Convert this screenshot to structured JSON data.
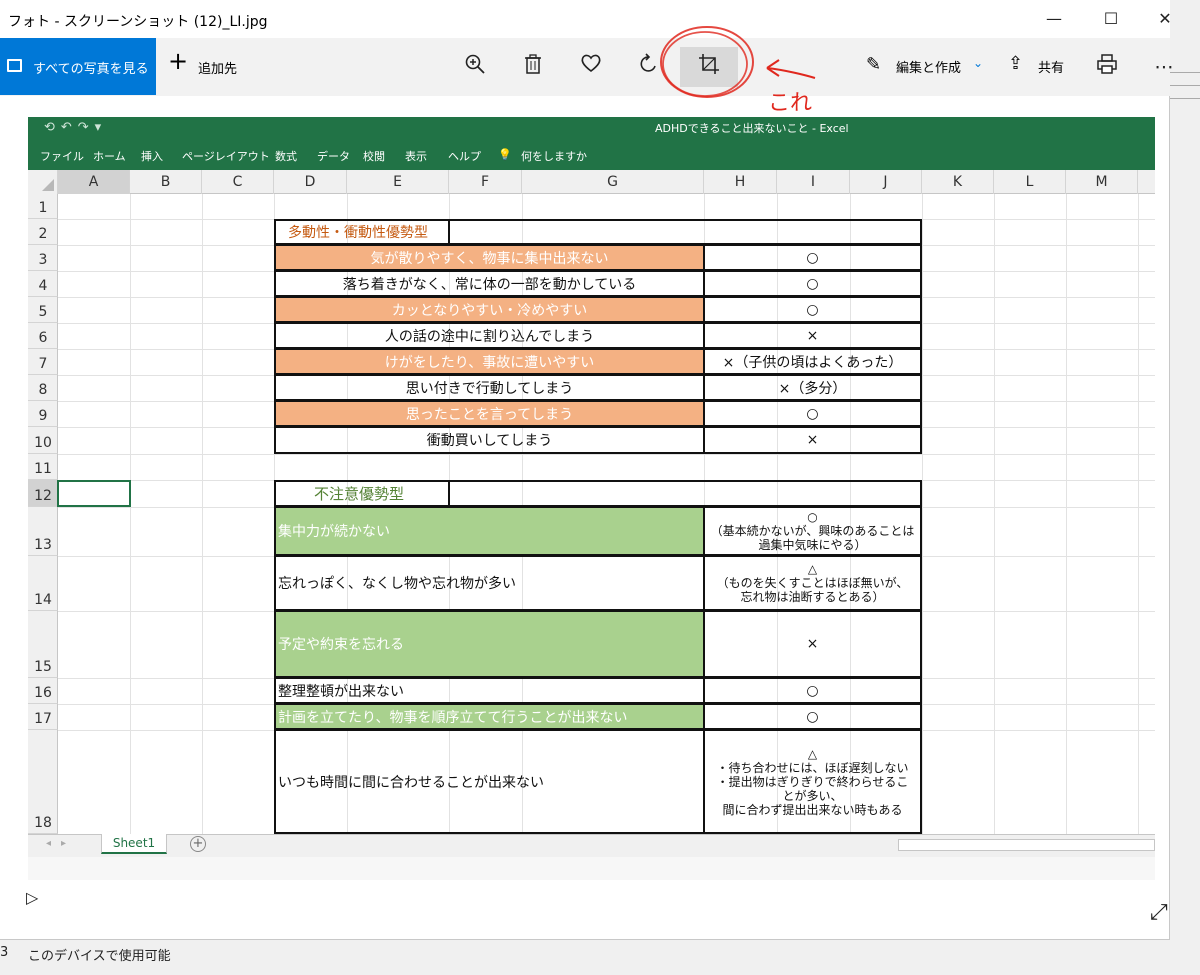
{
  "window": {
    "title": "フォト - スクリーンショット (12)_LI.jpg",
    "minimize": "—",
    "maximize": "☐",
    "close": "✕"
  },
  "toolbar": {
    "all_photos": "すべての写真を見る",
    "add_to": "追加先",
    "edit_create": "編集と作成",
    "share": "共有"
  },
  "annotation": {
    "text": "これ"
  },
  "excel": {
    "title": "ADHDできること出来ないこと - Excel",
    "menu": [
      "ファイル",
      "ホーム",
      "挿入",
      "ページレイアウト",
      "数式",
      "データ",
      "校閲",
      "表示",
      "ヘルプ",
      "何をしますか"
    ],
    "columns": [
      "A",
      "B",
      "C",
      "D",
      "E",
      "F",
      "G",
      "H",
      "I",
      "J",
      "K",
      "L",
      "M"
    ],
    "rows": [
      "1",
      "2",
      "3",
      "4",
      "5",
      "6",
      "7",
      "8",
      "9",
      "10",
      "11",
      "12",
      "13",
      "14",
      "15",
      "16",
      "17",
      "18"
    ],
    "section1": {
      "header": "多動性・衝動性優勢型",
      "items": [
        {
          "label": "気が散りやすく、物事に集中出来ない",
          "value": "○"
        },
        {
          "label": "落ち着きがなく、常に体の一部を動かしている",
          "value": "○"
        },
        {
          "label": "カッとなりやすい・冷めやすい",
          "value": "○"
        },
        {
          "label": "人の話の途中に割り込んでしまう",
          "value": "×"
        },
        {
          "label": "けがをしたり、事故に遭いやすい",
          "value": "×（子供の頃はよくあった）"
        },
        {
          "label": "思い付きで行動してしまう",
          "value": "×（多分）"
        },
        {
          "label": "思ったことを言ってしまう",
          "value": "○"
        },
        {
          "label": "衝動買いしてしまう",
          "value": "×"
        }
      ]
    },
    "section2": {
      "header": "不注意優勢型",
      "items": [
        {
          "label": "集中力が続かない",
          "value": [
            "○",
            "（基本続かないが、興味のあることは",
            "過集中気味にやる）"
          ]
        },
        {
          "label": "忘れっぽく、なくし物や忘れ物が多い",
          "value": [
            "△",
            "（ものを失くすことはほぼ無いが、",
            "忘れ物は油断するとある）"
          ]
        },
        {
          "label": "予定や約束を忘れる",
          "value": [
            "×"
          ]
        },
        {
          "label": "整理整頓が出来ない",
          "value": [
            "○"
          ]
        },
        {
          "label": "計画を立てたり、物事を順序立てて行うことが出来ない",
          "value": [
            "○"
          ]
        },
        {
          "label": "いつも時間に間に合わせることが出来ない",
          "value": [
            "△",
            "・待ち合わせには、ほぼ遅刻しない",
            "・提出物はぎりぎりで終わらせるこ",
            "とが多い、",
            "間に合わず提出出来ない時もある"
          ]
        }
      ]
    },
    "sheet_tab": "Sheet1"
  },
  "footer": {
    "number": "3",
    "text": "このデバイスで使用可能"
  }
}
